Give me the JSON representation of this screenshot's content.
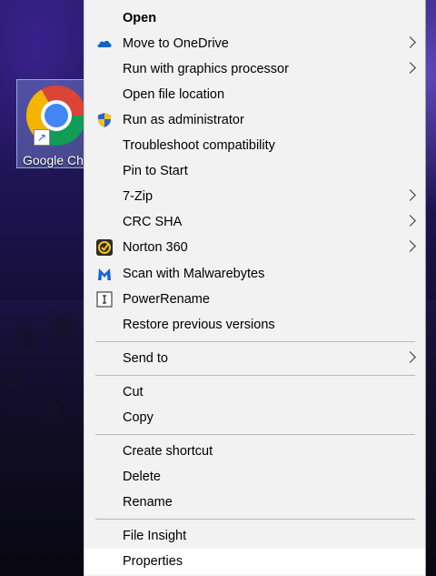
{
  "desktop": {
    "shortcut_label": "Google Ch"
  },
  "menu": {
    "items": [
      {
        "label": "Open",
        "bold": true
      },
      {
        "label": "Move to OneDrive",
        "icon": "onedrive-icon",
        "submenu": true
      },
      {
        "label": "Run with graphics processor",
        "submenu": true
      },
      {
        "label": "Open file location"
      },
      {
        "label": "Run as administrator",
        "icon": "uac-shield-icon"
      },
      {
        "label": "Troubleshoot compatibility"
      },
      {
        "label": "Pin to Start"
      },
      {
        "label": "7-Zip",
        "submenu": true
      },
      {
        "label": "CRC SHA",
        "submenu": true
      },
      {
        "label": "Norton 360",
        "icon": "norton-icon",
        "submenu": true
      },
      {
        "label": "Scan with Malwarebytes",
        "icon": "malwarebytes-icon"
      },
      {
        "label": "PowerRename",
        "icon": "powerrename-icon"
      },
      {
        "label": "Restore previous versions"
      },
      {
        "label": "Send to",
        "submenu": true
      },
      {
        "label": "Cut"
      },
      {
        "label": "Copy"
      },
      {
        "label": "Create shortcut"
      },
      {
        "label": "Delete"
      },
      {
        "label": "Rename"
      },
      {
        "label": "File Insight"
      },
      {
        "label": "Properties",
        "highlighted": true
      }
    ]
  },
  "colors": {
    "menu_background": "#f2f2f2",
    "highlight": "#ffffff",
    "separator": "#b9b9b9"
  }
}
